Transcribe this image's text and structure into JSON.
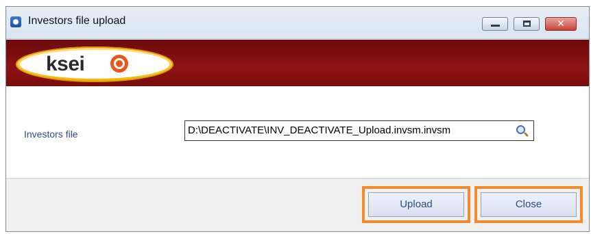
{
  "window": {
    "title": "Investors file upload",
    "controls": {
      "minimize_icon": "minimize-icon",
      "maximize_icon": "maximize-icon",
      "close_icon": "close-icon",
      "close_glyph": "✕"
    }
  },
  "banner": {
    "logo_text": "ksei",
    "colors": {
      "banner": "#7a0d0d",
      "logo_mark": "#e9561b",
      "logo_oval": "#f3b400"
    }
  },
  "form": {
    "investors_file": {
      "label": "Investors file",
      "value": "D:\\DEACTIVATE\\INV_DEACTIVATE_Upload.invsm.invsm",
      "browse_icon": "search-icon"
    }
  },
  "footer": {
    "upload_label": "Upload",
    "close_label": "Close",
    "highlight_color": "#f38a2b"
  }
}
